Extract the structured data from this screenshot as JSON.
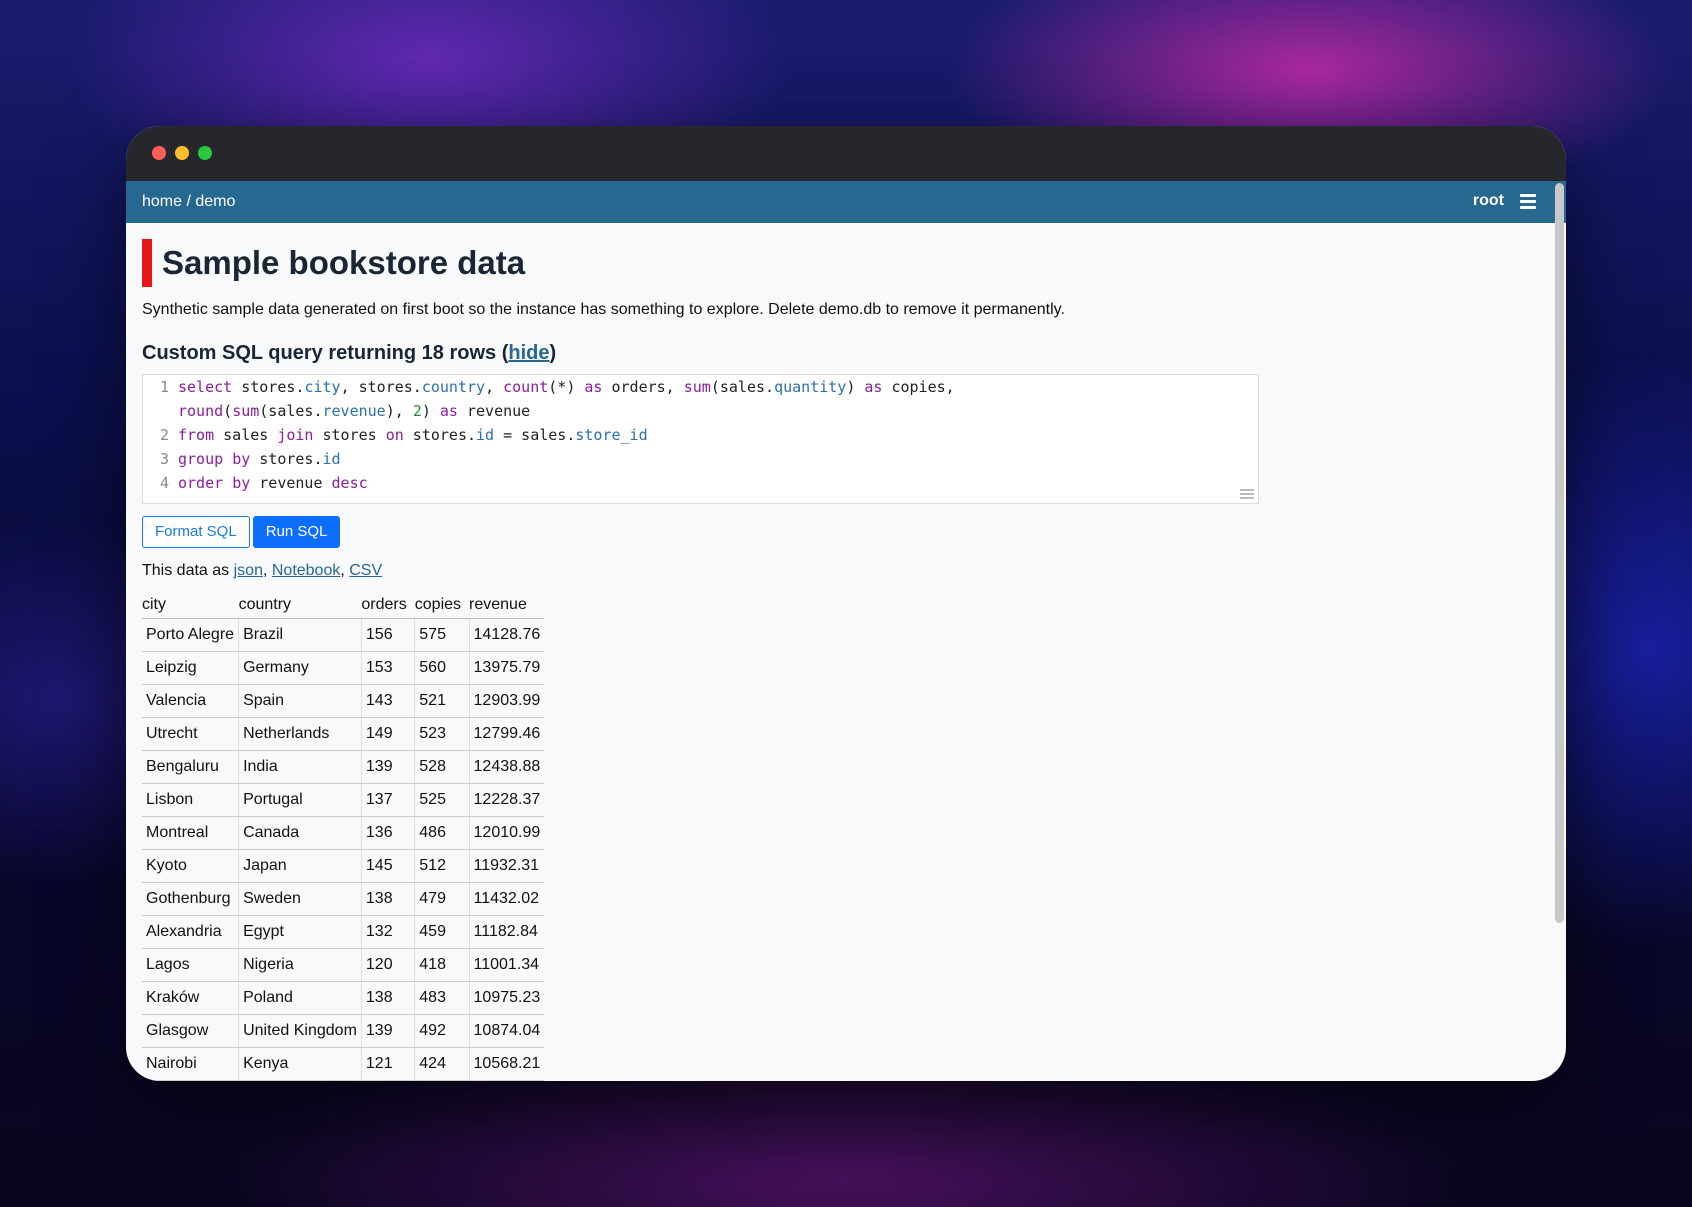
{
  "navbar": {
    "breadcrumb_home": "home",
    "breadcrumb_sep": " / ",
    "breadcrumb_db": "demo",
    "user": "root",
    "menu_icon": "hamburger-menu-icon"
  },
  "page": {
    "title": "Sample bookstore data",
    "description": "Synthetic sample data generated on first boot so the instance has something to explore. Delete demo.db to remove it permanently.",
    "query_heading": "Custom SQL query returning 18 rows (",
    "hide_link": "hide",
    "query_heading_close": ")"
  },
  "sql_lines": [
    {
      "num": "1",
      "text": "select stores.city, stores.country, count(*) as orders, sum(sales.quantity) as copies,"
    },
    {
      "num": "",
      "text": "round(sum(sales.revenue), 2) as revenue"
    },
    {
      "num": "2",
      "text": "from sales join stores on stores.id = sales.store_id"
    },
    {
      "num": "3",
      "text": "group by stores.id"
    },
    {
      "num": "4",
      "text": "order by revenue desc"
    }
  ],
  "buttons": {
    "format": "Format SQL",
    "run": "Run SQL"
  },
  "export": {
    "prefix": "This data as ",
    "json": "json",
    "notebook": "Notebook",
    "csv": "CSV"
  },
  "table": {
    "columns": [
      "city",
      "country",
      "orders",
      "copies",
      "revenue"
    ],
    "rows": [
      [
        "Porto Alegre",
        "Brazil",
        "156",
        "575",
        "14128.76"
      ],
      [
        "Leipzig",
        "Germany",
        "153",
        "560",
        "13975.79"
      ],
      [
        "Valencia",
        "Spain",
        "143",
        "521",
        "12903.99"
      ],
      [
        "Utrecht",
        "Netherlands",
        "149",
        "523",
        "12799.46"
      ],
      [
        "Bengaluru",
        "India",
        "139",
        "528",
        "12438.88"
      ],
      [
        "Lisbon",
        "Portugal",
        "137",
        "525",
        "12228.37"
      ],
      [
        "Montreal",
        "Canada",
        "136",
        "486",
        "12010.99"
      ],
      [
        "Kyoto",
        "Japan",
        "145",
        "512",
        "11932.31"
      ],
      [
        "Gothenburg",
        "Sweden",
        "138",
        "479",
        "11432.02"
      ],
      [
        "Alexandria",
        "Egypt",
        "132",
        "459",
        "11182.84"
      ],
      [
        "Lagos",
        "Nigeria",
        "120",
        "418",
        "11001.34"
      ],
      [
        "Kraków",
        "Poland",
        "138",
        "483",
        "10975.23"
      ],
      [
        "Glasgow",
        "United Kingdom",
        "139",
        "492",
        "10874.04"
      ],
      [
        "Nairobi",
        "Kenya",
        "121",
        "424",
        "10568.21"
      ]
    ]
  },
  "colors": {
    "navbar": "#276890",
    "title_accent": "#e8151b",
    "primary_button": "#0d6efd"
  }
}
